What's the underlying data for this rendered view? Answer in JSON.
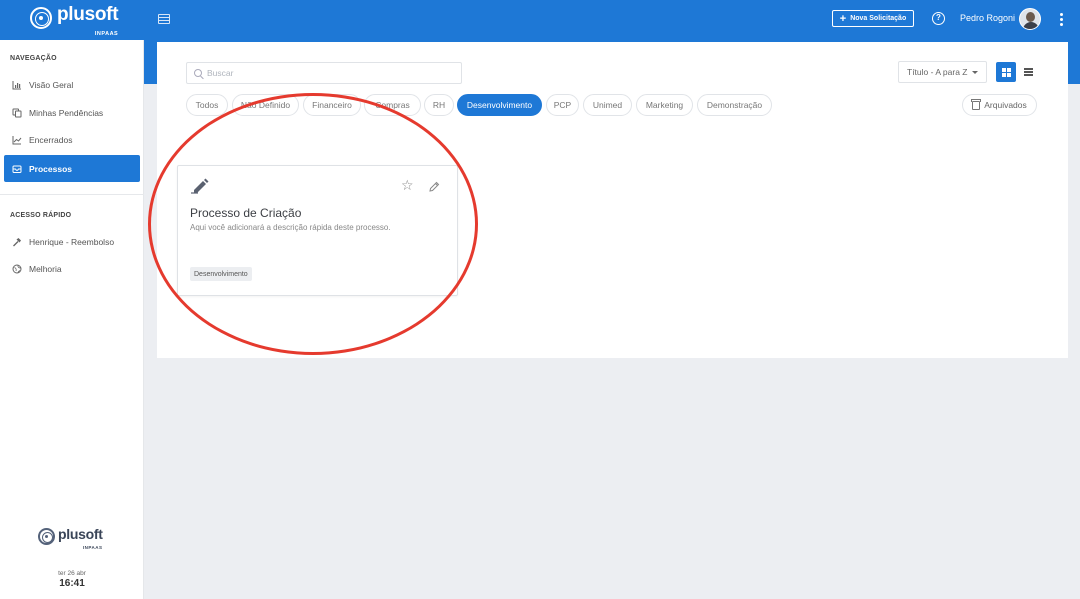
{
  "app": {
    "brand": "plusoft",
    "brand_sub": "INPAAS"
  },
  "header": {
    "new_request_label": "Nova Solicitação",
    "help_symbol": "?",
    "user_name": "Pedro Rogoni"
  },
  "sidebar": {
    "nav_title": "NAVEGAÇÃO",
    "nav_items": [
      {
        "label": "Visão Geral",
        "icon": "bar-chart-icon"
      },
      {
        "label": "Minhas Pendências",
        "icon": "copy-icon"
      },
      {
        "label": "Encerrados",
        "icon": "line-chart-icon"
      },
      {
        "label": "Processos",
        "icon": "inbox-icon",
        "active": true
      }
    ],
    "quick_title": "ACESSO RÁPIDO",
    "quick_items": [
      {
        "label": "Henrique - Reembolso",
        "icon": "hammer-icon"
      },
      {
        "label": "Melhoria",
        "icon": "globe-icon"
      }
    ],
    "footer": {
      "brand": "plusoft",
      "brand_sub": "INPAAS",
      "date": "ter 26 abr",
      "time": "16:41"
    }
  },
  "toolbar": {
    "search_placeholder": "Buscar",
    "sort_label": "Título - A para Z",
    "archived_label": "Arquivados"
  },
  "filters": [
    {
      "label": "Todos"
    },
    {
      "label": "Não Definido"
    },
    {
      "label": "Financeiro"
    },
    {
      "label": "Compras"
    },
    {
      "label": "RH"
    },
    {
      "label": "Desenvolvimento",
      "active": true
    },
    {
      "label": "PCP"
    },
    {
      "label": "Unimed"
    },
    {
      "label": "Marketing"
    },
    {
      "label": "Demonstração"
    }
  ],
  "cards": [
    {
      "title": "Processo de Criação",
      "description": "Aqui você adicionará a descrição rápida deste processo.",
      "tag": "Desenvolvimento",
      "icon": "pen-icon"
    }
  ],
  "colors": {
    "primary": "#1e78d6",
    "annotation": "#e53a2e"
  }
}
